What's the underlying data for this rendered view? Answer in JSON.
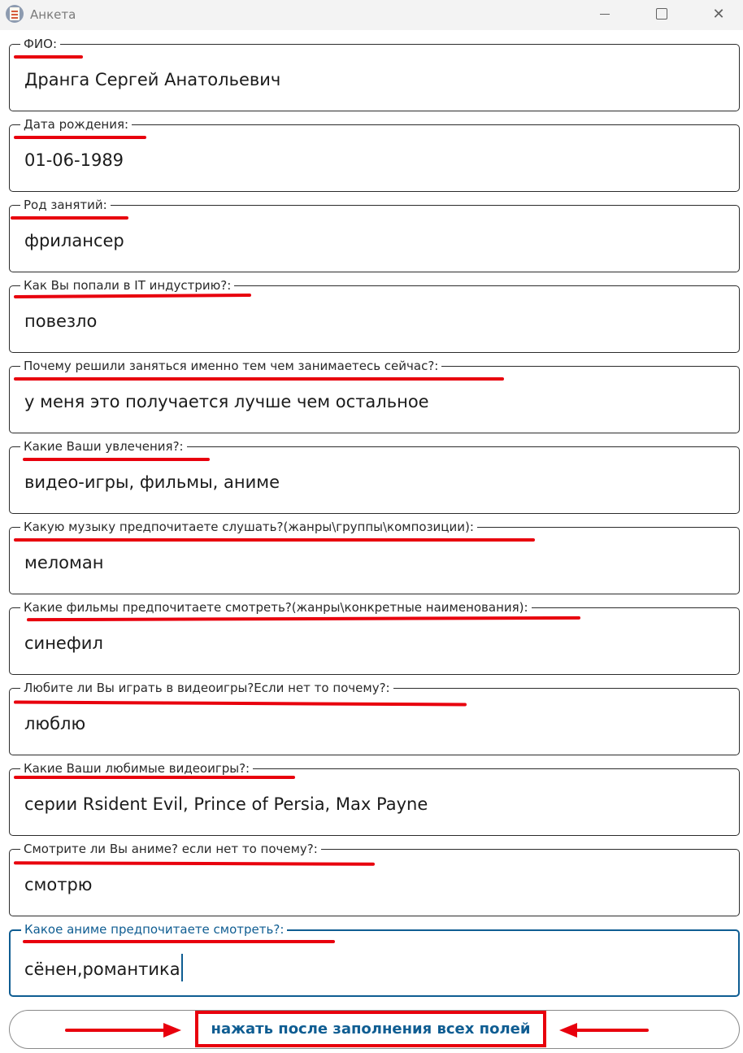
{
  "window": {
    "title": "Анкета",
    "app_icon": "questionnaire-app-icon",
    "minimize_icon": "minimize-icon",
    "maximize_icon": "maximize-icon",
    "close_icon": "close-icon",
    "close_glyph": "✕"
  },
  "form": {
    "fields": [
      {
        "label": "ФИО:",
        "value": "Дранга Сергей Анатольевич"
      },
      {
        "label": "Дата рождения:",
        "value": "01-06-1989"
      },
      {
        "label": "Род занятий:",
        "value": "фрилансер"
      },
      {
        "label": "Как Вы попали в IT индустрию?:",
        "value": "повезло"
      },
      {
        "label": "Почему решили заняться именно тем чем занимаетесь сейчас?:",
        "value": "у меня это получается лучше чем остальное"
      },
      {
        "label": "Какие Ваши увлечения?:",
        "value": "видео-игры, фильмы, аниме"
      },
      {
        "label": "Какую музыку предпочитаете слушать?(жанры\\группы\\композиции):",
        "value": "меломан"
      },
      {
        "label": "Какие фильмы предпочитаете смотреть?(жанры\\конкретные наименования):",
        "value": "синефил"
      },
      {
        "label": "Любите ли Вы играть в видеоигры?Если нет то почему?:",
        "value": "люблю"
      },
      {
        "label": "Какие Ваши любимые видеоигры?:",
        "value": "серии Rsident Evil, Prince of Persia, Max Payne"
      },
      {
        "label": "Смотрите ли Вы аниме? если нет то почему?:",
        "value": "смотрю"
      },
      {
        "label": "Какое аниме предпочитаете смотреть?:",
        "value": "сёнен,романтика"
      }
    ],
    "submit_label": "нажать после заполнения всех полей"
  },
  "colors": {
    "accent": "#0f5d92",
    "annotation_red": "#e8000d",
    "field_border": "#2b2b2b",
    "titlebar_bg": "#f3f3f3"
  }
}
